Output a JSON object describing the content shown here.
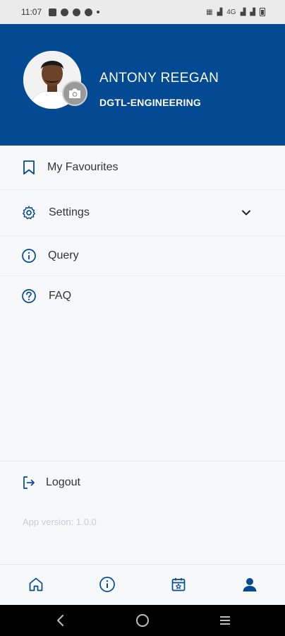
{
  "status_bar": {
    "time": "11:07",
    "network": "4G"
  },
  "profile": {
    "name": "ANTONY REEGAN",
    "department": "DGTL-ENGINEERING"
  },
  "menu": {
    "favourites": "My Favourites",
    "settings": "Settings",
    "query": "Query",
    "faq": "FAQ",
    "logout": "Logout"
  },
  "app_version": "App version: 1.0.0",
  "colors": {
    "brand": "#034a92",
    "active_nav": "#034a92"
  },
  "bottom_nav": {
    "items": [
      "home-icon",
      "info-icon",
      "calendar-icon",
      "profile-icon"
    ],
    "active": "profile-icon"
  }
}
